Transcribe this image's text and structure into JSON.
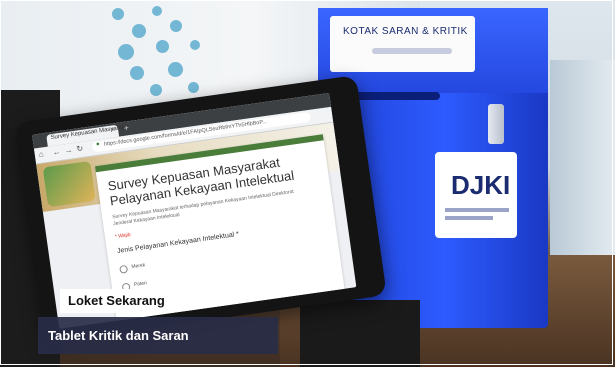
{
  "box_sign": {
    "title": "KOTAK SARAN & KRITIK"
  },
  "box_logo": {
    "text": "DJKI"
  },
  "browser": {
    "tab_label": "Survey Kepuasan Masyarak",
    "tab_close_icon": "close-icon",
    "new_tab_icon": "plus-icon",
    "url": "https://docs.google.com/forms/d/e/1FAIpQLSeuRbfmYTh5HlbBoP..."
  },
  "form": {
    "title": "Survey Kepuasan Masyarakat Pelayanan Kekayaan Intelektual",
    "description": "Survey Kepuasan Masyarakat terhadap pelayanan Kekayaan Intelektual Direktorat Jenderal Kekayaan Intelektual",
    "required_note": "* Wajib",
    "question": "Jenis Pelayanan Kekayaan Intelektual *",
    "options": [
      "Merek",
      "Paten"
    ]
  },
  "captions": {
    "top": "Loket Sekarang",
    "bottom": "Tablet Kritik dan Saran"
  }
}
